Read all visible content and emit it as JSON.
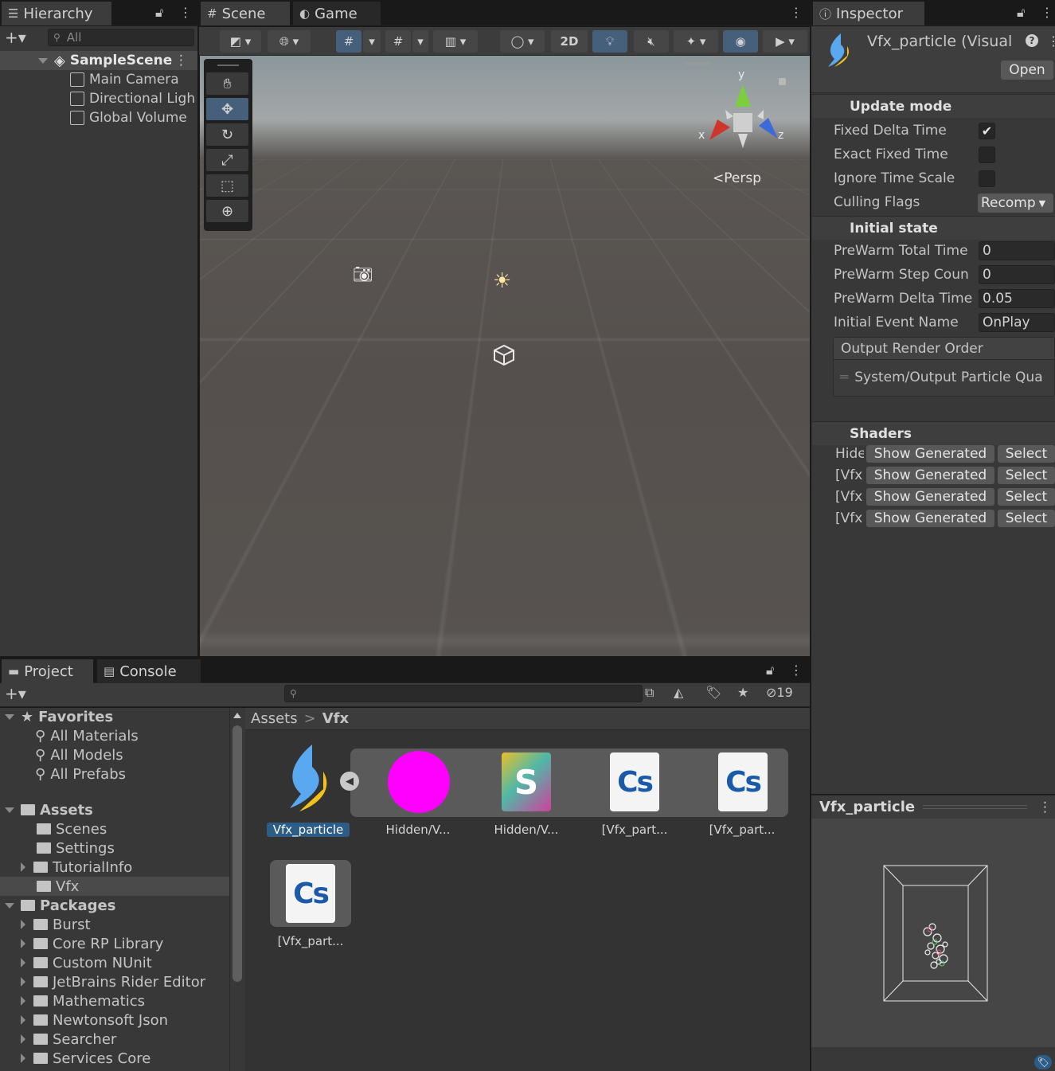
{
  "hierarchy": {
    "tab_label": "Hierarchy",
    "search_placeholder": "All",
    "scene_name": "SampleScene",
    "items": [
      {
        "label": "Main Camera"
      },
      {
        "label": "Directional Ligh"
      },
      {
        "label": "Global Volume"
      }
    ]
  },
  "scene_view": {
    "tabs": [
      {
        "label": "Scene"
      },
      {
        "label": "Game"
      }
    ],
    "toolbar": {
      "btn_2d": "2D"
    },
    "gizmo": {
      "y": "y",
      "x": "x",
      "z": "z",
      "persp": "Persp"
    }
  },
  "inspector": {
    "tab_label": "Inspector",
    "object_title": "Vfx_particle (Visual",
    "open_button": "Open",
    "update_mode": {
      "title": "Update mode",
      "fixed_delta_time": "Fixed Delta Time",
      "fixed_delta_time_checked": "✔",
      "exact_fixed_time": "Exact Fixed Time",
      "ignore_time_scale": "Ignore Time Scale",
      "culling_flags": "Culling Flags",
      "culling_value": "Recomp"
    },
    "initial_state": {
      "title": "Initial state",
      "prewarm_total_label": "PreWarm Total Time",
      "prewarm_total_value": "0",
      "prewarm_step_label": "PreWarm Step Coun",
      "prewarm_step_value": "0",
      "prewarm_delta_label": "PreWarm Delta Time",
      "prewarm_delta_value": "0.05",
      "initial_event_label": "Initial Event Name",
      "initial_event_value": "OnPlay"
    },
    "output_render_order": {
      "title": "Output Render Order",
      "item": "System/Output Particle Qua"
    },
    "shaders": {
      "title": "Shaders",
      "rows": [
        {
          "name": "Hide",
          "show": "Show Generated",
          "select": "Select"
        },
        {
          "name": "[Vfx",
          "show": "Show Generated",
          "select": "Select"
        },
        {
          "name": "[Vfx",
          "show": "Show Generated",
          "select": "Select"
        },
        {
          "name": "[Vfx",
          "show": "Show Generated",
          "select": "Select"
        }
      ]
    },
    "preview_title": "Vfx_particle"
  },
  "project": {
    "tabs": [
      {
        "label": "Project"
      },
      {
        "label": "Console"
      }
    ],
    "hidden_count": "19",
    "breadcrumb": {
      "root": "Assets",
      "current": "Vfx"
    },
    "favorites": {
      "title": "Favorites",
      "items": [
        {
          "label": "All Materials"
        },
        {
          "label": "All Models"
        },
        {
          "label": "All Prefabs"
        }
      ]
    },
    "assets": {
      "title": "Assets",
      "items": [
        {
          "label": "Scenes"
        },
        {
          "label": "Settings"
        },
        {
          "label": "TutorialInfo"
        },
        {
          "label": "Vfx"
        }
      ]
    },
    "packages": {
      "title": "Packages",
      "items": [
        {
          "label": "Burst"
        },
        {
          "label": "Core RP Library"
        },
        {
          "label": "Custom NUnit"
        },
        {
          "label": "JetBrains Rider Editor"
        },
        {
          "label": "Mathematics"
        },
        {
          "label": "Newtonsoft Json"
        },
        {
          "label": "Searcher"
        },
        {
          "label": "Services Core"
        }
      ]
    },
    "grid_items": [
      {
        "label": "Vfx_particle"
      },
      {
        "label": "Hidden/V..."
      },
      {
        "label": "Hidden/V..."
      },
      {
        "label": "[Vfx_part..."
      },
      {
        "label": "[Vfx_part..."
      },
      {
        "label": "[Vfx_part..."
      }
    ],
    "icon_text": {
      "shader": "S",
      "cs": "Cs"
    }
  },
  "colors": {
    "accent": "#46607c",
    "selection": "#2c5d87",
    "magenta": "#ff00ff"
  }
}
